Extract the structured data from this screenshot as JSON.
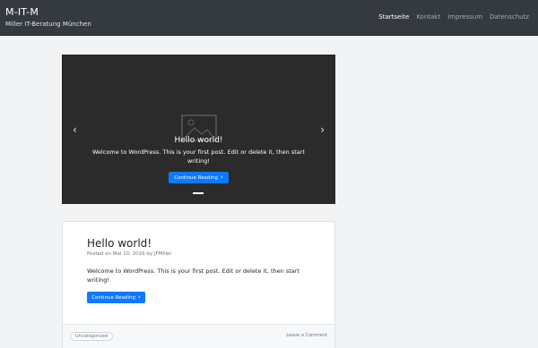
{
  "header": {
    "site_title": "M-IT-M",
    "tagline": "Miller IT-Beratung München",
    "nav": [
      {
        "label": "Startseite",
        "active": true
      },
      {
        "label": "Kontakt",
        "active": false
      },
      {
        "label": "Impressum",
        "active": false
      },
      {
        "label": "Datenschutz",
        "active": false
      }
    ]
  },
  "carousel": {
    "icon": "image-placeholder-icon",
    "title": "Hello world!",
    "text": "Welcome to WordPress. This is your first post. Edit or delete it, then start writing!",
    "button_label": "Continue Reading",
    "prev_icon": "chevron-left-icon",
    "next_icon": "chevron-right-icon"
  },
  "post": {
    "title": "Hello world!",
    "meta_prefix": "Posted on",
    "date": "Mai 10, 2016",
    "meta_by": "by",
    "author": "JFMiller",
    "excerpt": "Welcome to WordPress. This is your first post. Edit or delete it, then start writing!",
    "button_label": "Continue Reading",
    "category": "Uncategorized",
    "comment_link": "Leave a Comment"
  },
  "colors": {
    "header_bg": "#343a40",
    "accent": "#0d79ff",
    "page_bg": "#f1f3f5"
  }
}
